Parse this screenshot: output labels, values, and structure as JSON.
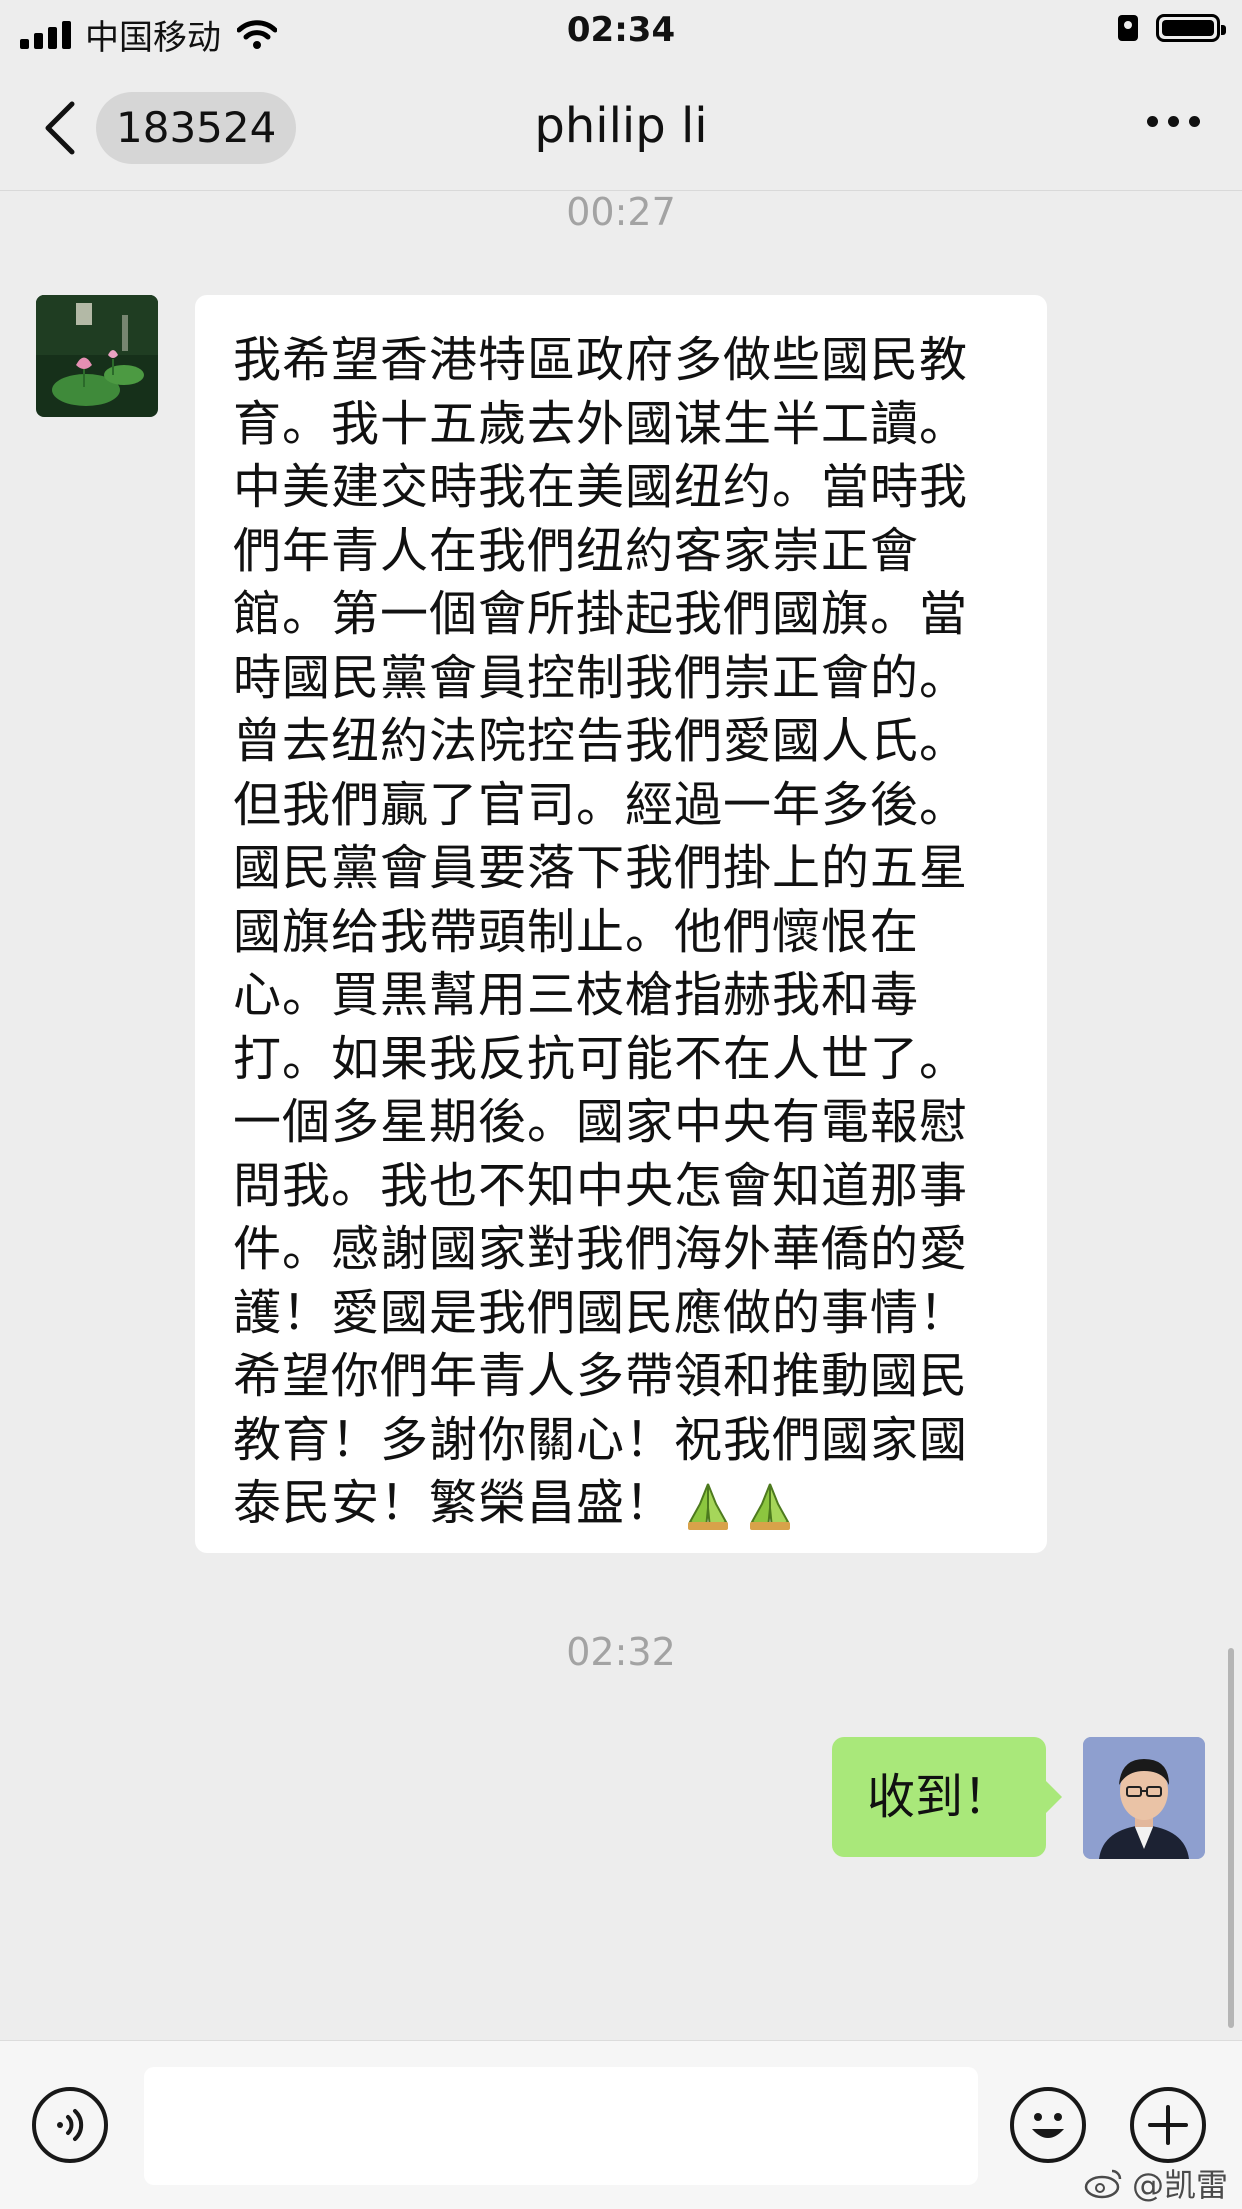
{
  "status_bar": {
    "carrier": "中国移动",
    "time": "02:34"
  },
  "nav": {
    "unread_count": "183524",
    "title": "philip li"
  },
  "chat": {
    "timestamp_1": "00:27",
    "incoming_message_lines": [
      "我希望香港特區政府多做些國民教",
      "育。我十五歲去外國谋生半工讀。",
      "中美建交時我在美國纽约。當時我",
      "們年青人在我們纽約客家崇正會",
      "館。第一個會所掛起我們國旗。當",
      "時國民黨會員控制我們崇正會的。",
      "曾去纽約法院控告我們愛國人氏。",
      "但我們贏了官司。經過一年多後。",
      "國民黨會員要落下我們掛上的五星",
      "國旗给我帶頭制止。他們懷恨在",
      "心。買黒幫用三枝槍指赫我和毒",
      "打。如果我反抗可能不在人世了。",
      "一個多星期後。國家中央有電報慰",
      "問我。我也不知中央怎會知道那事",
      "件。感謝國家對我們海外華僑的愛",
      "護！愛國是我們國民應做的事情！",
      "希望你們年青人多帶領和推動國民",
      "教育！多謝你關心！祝我們國家國",
      "泰民安！繁榮昌盛！"
    ],
    "timestamp_2": "02:32",
    "outgoing_message": "收到！"
  },
  "input": {
    "placeholder": ""
  },
  "watermark": {
    "text": "@凯雷"
  },
  "colors": {
    "background": "#ededed",
    "outgoing_bubble": "#a9e87a",
    "incoming_bubble": "#ffffff"
  },
  "icons": [
    "signal-icon",
    "wifi-icon",
    "lock-icon",
    "battery-icon",
    "back-chevron-icon",
    "more-icon",
    "voice-icon",
    "emoji-icon",
    "plus-icon",
    "pray-emoji-icon"
  ]
}
